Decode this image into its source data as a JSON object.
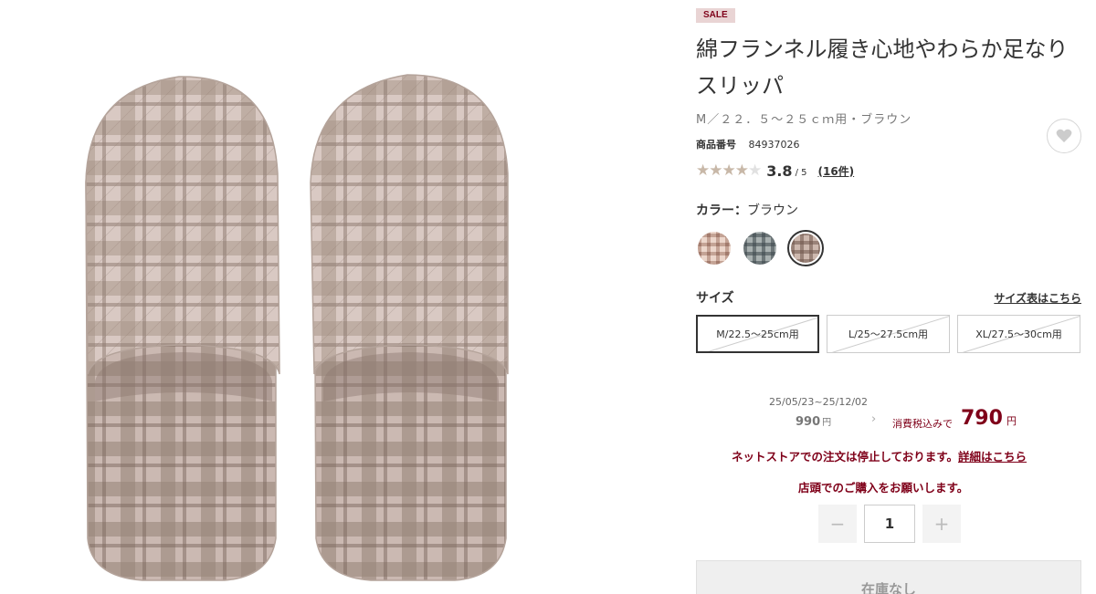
{
  "product": {
    "sale_badge": "SALE",
    "title": "綿フランネル履き心地やわらか足なりスリッパ",
    "variant": "M／２２．５〜２５ｃｍ用・ブラウン",
    "item_no_label": "商品番号",
    "item_no": "84937026"
  },
  "rating": {
    "stars_filled": 4,
    "stars_total": 5,
    "score": "3.8",
    "max": "/ 5",
    "reviews": "(16件)"
  },
  "color": {
    "label": "カラー：",
    "value": "ブラウン",
    "swatches": [
      {
        "name": "pink-check",
        "selected": false
      },
      {
        "name": "gray-check",
        "selected": false
      },
      {
        "name": "brown-check",
        "selected": true
      }
    ]
  },
  "size": {
    "label": "サイズ",
    "chart_link": "サイズ表はこちら",
    "options": [
      {
        "label": "M/22.5〜25cm用",
        "selected": true
      },
      {
        "label": "L/25〜27.5cm用",
        "selected": false
      },
      {
        "label": "XL/27.5〜30cm用",
        "selected": false
      }
    ]
  },
  "price": {
    "period": "25/05/23~25/12/02",
    "old": "990",
    "old_unit": "円",
    "tax_label": "消費税込みで",
    "new": "790",
    "new_unit": "円"
  },
  "notice": {
    "line1": "ネットストアでの注文は停止しております。",
    "link": "詳細はこちら",
    "line2": "店頭でのご購入をお願いします。"
  },
  "quantity": {
    "minus": "−",
    "value": "1",
    "plus": "+"
  },
  "stock_button": "在庫なし",
  "colors": {
    "accent": "#7f0019",
    "sale_bg": "#e9d4d4"
  }
}
